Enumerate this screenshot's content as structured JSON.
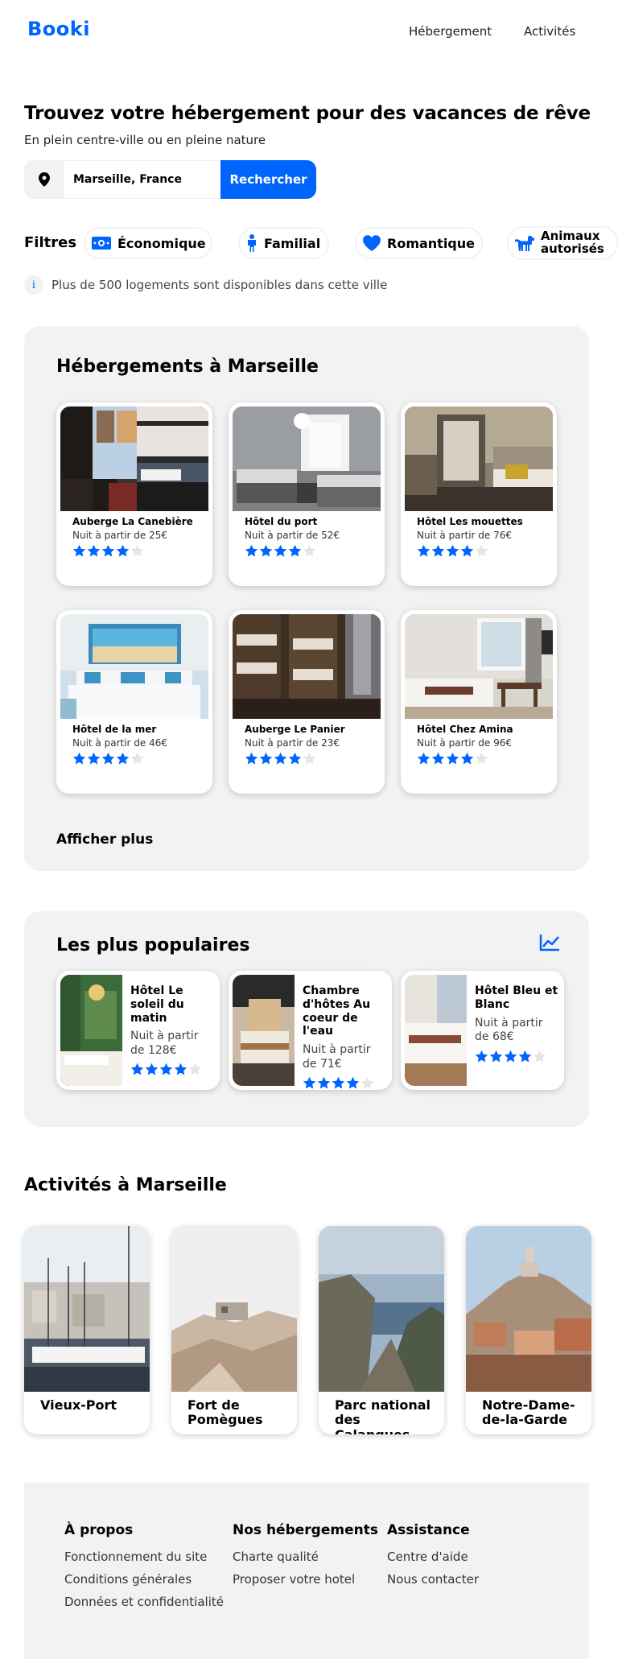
{
  "header": {
    "logo": "Booki",
    "nav": [
      "Hébergement",
      "Activités"
    ]
  },
  "hero": {
    "title": "Trouvez votre hébergement pour des vacances de rêve",
    "subtitle": "En plein centre-ville ou en pleine nature"
  },
  "search": {
    "value": "Marseille, France",
    "button": "Rechercher"
  },
  "filters": {
    "label": "Filtres",
    "items": [
      {
        "label": "Économique",
        "icon": "money-icon"
      },
      {
        "label": "Familial",
        "icon": "person-icon"
      },
      {
        "label": "Romantique",
        "icon": "heart-icon"
      },
      {
        "label": "Animaux autorisés",
        "icon": "dog-icon"
      }
    ]
  },
  "info": {
    "text": "Plus de 500 logements sont disponibles dans cette ville"
  },
  "lodgings": {
    "title": "Hébergements à Marseille",
    "cards": [
      {
        "name": "Auberge La Canebière",
        "price": "Nuit à partir de 25€",
        "rating": 4
      },
      {
        "name": "Hôtel du port",
        "price": "Nuit à partir de 52€",
        "rating": 4
      },
      {
        "name": "Hôtel Les mouettes",
        "price": "Nuit à partir de 76€",
        "rating": 4
      },
      {
        "name": "Hôtel de la mer",
        "price": "Nuit à partir de 46€",
        "rating": 4
      },
      {
        "name": "Auberge Le Panier",
        "price": "Nuit à partir de 23€",
        "rating": 4
      },
      {
        "name": "Hôtel Chez Amina",
        "price": "Nuit à partir de 96€",
        "rating": 4
      }
    ],
    "more": "Afficher plus"
  },
  "popular": {
    "title": "Les plus populaires",
    "cards": [
      {
        "name": "Hôtel Le soleil du matin",
        "price": "Nuit à partir de 128€",
        "rating": 4
      },
      {
        "name": "Chambre d'hôtes Au coeur de l'eau",
        "price": "Nuit à partir de 71€",
        "rating": 4
      },
      {
        "name": "Hôtel Bleu et Blanc",
        "price": "Nuit à partir de 68€",
        "rating": 4
      }
    ]
  },
  "activities": {
    "title": "Activités à Marseille",
    "cards": [
      {
        "name": "Vieux-Port"
      },
      {
        "name": "Fort de Pomègues"
      },
      {
        "name": "Parc national des Calanques"
      },
      {
        "name": "Notre-Dame-de-la-Garde"
      }
    ]
  },
  "footer": {
    "columns": [
      {
        "title": "À propos",
        "links": [
          "Fonctionnement du site",
          "Conditions générales",
          "Données et confidentialité"
        ]
      },
      {
        "title": "Nos hébergements",
        "links": [
          "Charte qualité",
          "Proposer votre hotel"
        ]
      },
      {
        "title": "Assistance",
        "links": [
          "Centre d'aide",
          "Nous contacter"
        ]
      }
    ]
  },
  "colors": {
    "accent": "#0065fc",
    "panel": "#f2f2f2",
    "star_off": "#e5e5e5"
  }
}
